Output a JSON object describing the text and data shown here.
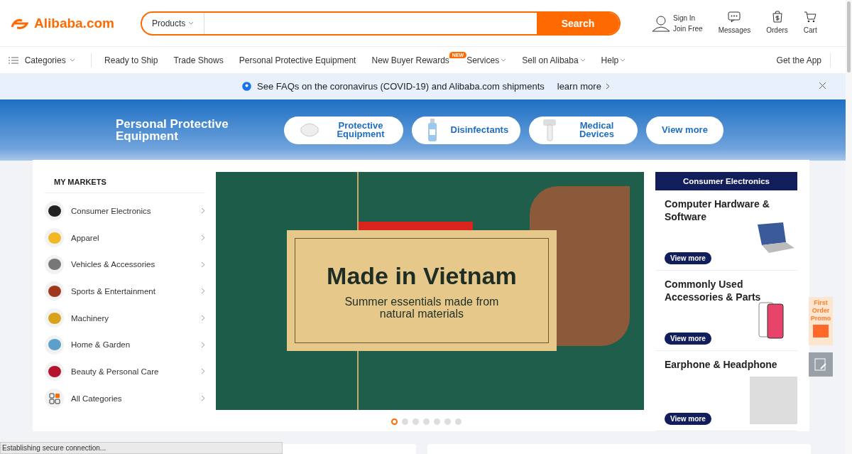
{
  "header": {
    "logo": "Alibaba.com",
    "search": {
      "category": "Products",
      "button": "Search"
    },
    "account": {
      "sign_in": "Sign In",
      "join": "Join Free"
    },
    "actions": [
      {
        "kind": "messages",
        "label": "Messages"
      },
      {
        "kind": "orders",
        "label": "Orders"
      },
      {
        "kind": "cart",
        "label": "Cart"
      }
    ]
  },
  "nav": {
    "categories": "Categories",
    "items": [
      {
        "label": "Ready to Ship",
        "dropdown": false
      },
      {
        "label": "Trade Shows",
        "dropdown": false
      },
      {
        "label": "Personal Protective Equipment",
        "dropdown": false
      },
      {
        "label": "New Buyer Rewards",
        "dropdown": false,
        "badge": "NEW"
      },
      {
        "label": "Services",
        "dropdown": true
      },
      {
        "label": "Sell on Alibaba",
        "dropdown": true
      },
      {
        "label": "Help",
        "dropdown": true
      }
    ],
    "app": "Get the App"
  },
  "notice": {
    "text": "See FAQs on the coronavirus (COVID-19) and Alibaba.com shipments",
    "link": "learn more"
  },
  "hero": {
    "title": "Personal Protective Equipment",
    "chips": [
      {
        "kind": "mask",
        "label": "Protective Equipment"
      },
      {
        "kind": "bottle",
        "label": "Disinfectants"
      },
      {
        "kind": "thermometer",
        "label": "Medical Devices"
      },
      {
        "kind": "none",
        "label": "View more"
      }
    ]
  },
  "markets": {
    "title": "MY MARKETS",
    "items": [
      {
        "kind": "electronics",
        "label": "Consumer Electronics"
      },
      {
        "kind": "apparel",
        "label": "Apparel"
      },
      {
        "kind": "vehicles",
        "label": "Vehicles & Accessories"
      },
      {
        "kind": "sports",
        "label": "Sports & Entertainment"
      },
      {
        "kind": "machinery",
        "label": "Machinery"
      },
      {
        "kind": "home",
        "label": "Home & Garden"
      },
      {
        "kind": "beauty",
        "label": "Beauty & Personal Care"
      },
      {
        "kind": "all",
        "label": "All Categories"
      }
    ]
  },
  "banner": {
    "title": "Made in Vietnam",
    "subtitle": "Summer essentials made from natural materials",
    "dots": [
      {
        "selected": true
      },
      {
        "selected": false
      },
      {
        "selected": false
      },
      {
        "selected": false
      },
      {
        "selected": false
      },
      {
        "selected": false
      },
      {
        "selected": false
      }
    ]
  },
  "featured": {
    "heading": "Consumer Electronics",
    "items": [
      {
        "kind": "laptop",
        "title": "Computer Hardware & Software",
        "button": "View more"
      },
      {
        "kind": "phone",
        "title": "Commonly Used Accessories & Parts",
        "button": "View more"
      },
      {
        "kind": "earbuds",
        "title": "Earphone & Headphone",
        "button": "View more"
      }
    ]
  },
  "side": {
    "promo": "First Order Promo"
  },
  "status": "Establishing secure connection..."
}
